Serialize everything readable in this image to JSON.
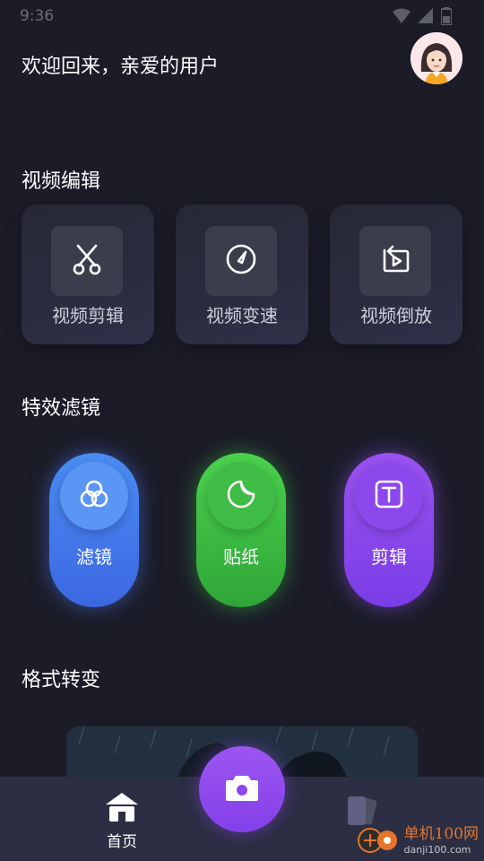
{
  "status_bar": {
    "time": "9:36"
  },
  "header": {
    "greeting": "欢迎回来，亲爱的用户"
  },
  "sections": {
    "video_edit": {
      "title": "视频编辑",
      "cards": [
        {
          "label": "视频剪辑",
          "icon": "scissors-icon"
        },
        {
          "label": "视频变速",
          "icon": "speed-gauge-icon"
        },
        {
          "label": "视频倒放",
          "icon": "reverse-play-icon"
        }
      ]
    },
    "effects": {
      "title": "特效滤镜",
      "items": [
        {
          "label": "滤镜",
          "icon": "filter-circles-icon",
          "color": "#4a7ff0"
        },
        {
          "label": "贴纸",
          "icon": "sticker-icon",
          "color": "#3cbf43"
        },
        {
          "label": "剪辑",
          "icon": "text-box-icon",
          "color": "#8b48ec"
        }
      ]
    },
    "format": {
      "title": "格式转变"
    }
  },
  "bottom_nav": {
    "home_label": "首页",
    "camera_icon": "camera-icon",
    "cards_icon": "cards-icon"
  },
  "watermark": {
    "main": "单机100网",
    "sub": "danji100.com"
  },
  "colors": {
    "background": "#1b1c28",
    "nav_bg": "#2c2e44",
    "accent_purple": "#8b48ec",
    "watermark_orange": "#e6752b"
  }
}
